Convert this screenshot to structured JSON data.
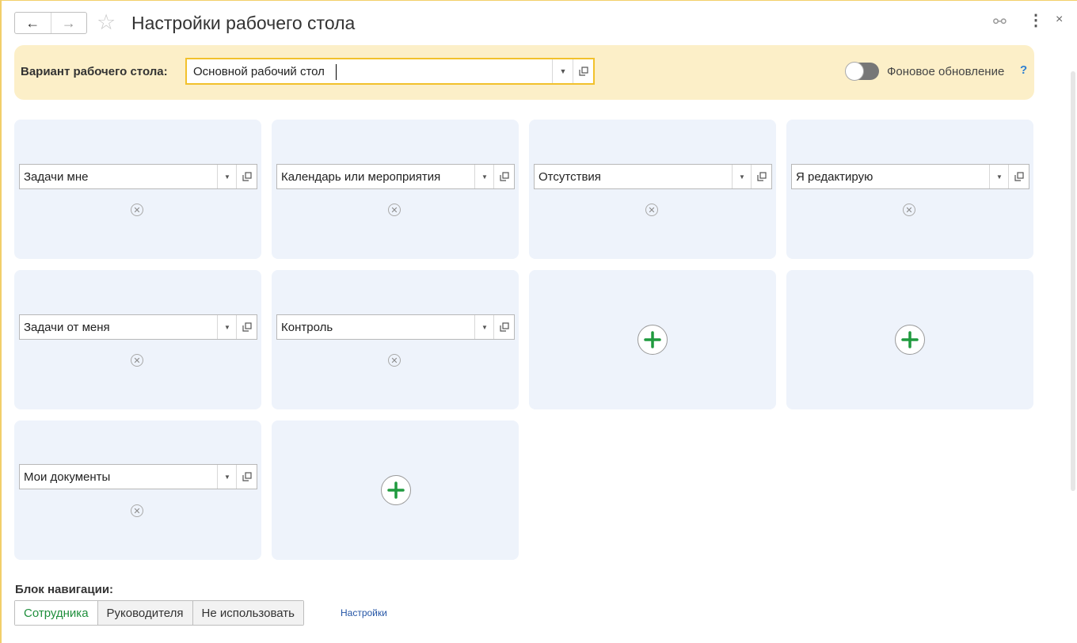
{
  "header": {
    "title": "Настройки рабочего стола",
    "nav_back": "←",
    "nav_forward": "→",
    "star_glyph": "☆",
    "link_glyph": "⚯",
    "more_glyph": "⋮",
    "close_glyph": "×"
  },
  "variant": {
    "label": "Вариант рабочего стола:",
    "value": "Основной рабочий стол",
    "dropdown_glyph": "▼"
  },
  "background_update": {
    "label": "Фоновое обновление",
    "enabled": false,
    "help": "?"
  },
  "tiles": [
    {
      "label": "Задачи мне",
      "remove": "✕"
    },
    {
      "label": "Календарь или мероприятия",
      "remove": "✕"
    },
    {
      "label": "Отсутствия",
      "remove": "✕"
    },
    {
      "label": "Я редактирую",
      "remove": "✕"
    },
    {
      "label": "Задачи от меня",
      "remove": "✕"
    },
    {
      "label": "Контроль",
      "remove": "✕"
    },
    {
      "label": "Мои документы",
      "remove": "✕"
    }
  ],
  "navigation_block": {
    "label": "Блок навигации:",
    "options": [
      "Сотрудника",
      "Руководителя",
      "Не использовать"
    ],
    "selected": "Сотрудника",
    "settings_link": "Настройки"
  },
  "colors": {
    "accent_yellow": "#f2c12c",
    "panel_yellow": "#fcefc8",
    "tile_bg": "#eef3fb",
    "add_green": "#1f9a3e",
    "selected_green": "#1f8f3c",
    "link_blue": "#2455a6"
  }
}
